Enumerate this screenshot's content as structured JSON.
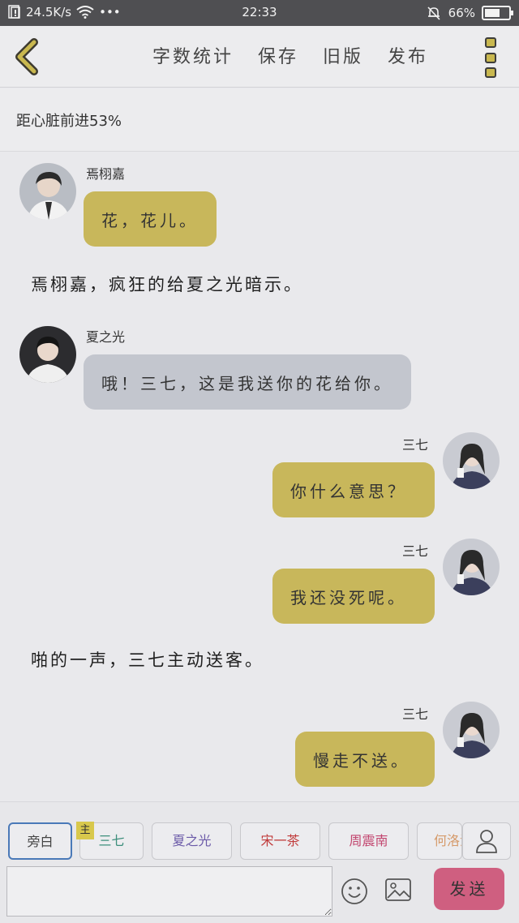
{
  "status_bar": {
    "net_speed": "24.5K/s",
    "dots": "•••",
    "time": "22:33",
    "battery": "66%",
    "battery_level": 0.66
  },
  "top_bar": {
    "actions": [
      "字数统计",
      "保存",
      "旧版",
      "发布"
    ]
  },
  "progress_text": "距心脏前进53%",
  "messages": [
    {
      "type": "msg",
      "side": "left",
      "sender": "焉栩嘉",
      "text": "花，花儿。",
      "color": "gold"
    },
    {
      "type": "narration",
      "text": "焉栩嘉，疯狂的给夏之光暗示。"
    },
    {
      "type": "msg",
      "side": "left",
      "sender": "夏之光",
      "text": "哦！三七，这是我送你的花给你。",
      "color": "gray"
    },
    {
      "type": "msg",
      "side": "right",
      "sender": "三七",
      "text": "你什么意思？",
      "color": "gold"
    },
    {
      "type": "msg",
      "side": "right",
      "sender": "三七",
      "text": "我还没死呢。",
      "color": "gold"
    },
    {
      "type": "narration",
      "text": "啪的一声，三七主动送客。"
    },
    {
      "type": "msg",
      "side": "right",
      "sender": "三七",
      "text": "慢走不送。",
      "color": "gold"
    }
  ],
  "roles": [
    {
      "label": "旁白",
      "color": "#444444"
    },
    {
      "label": "三七",
      "color": "#3d8f7c"
    },
    {
      "label": "夏之光",
      "color": "#6b5aa8"
    },
    {
      "label": "宋一茶",
      "color": "#c03a3a"
    },
    {
      "label": "周震南",
      "color": "#c2466f"
    },
    {
      "label": "何洛洛",
      "color": "#d59a6a"
    }
  ],
  "main_badge": "主",
  "input": {
    "value": "",
    "placeholder": ""
  },
  "send_label": "发送",
  "icons": {
    "back": "chevron-left-icon",
    "more": "more-vertical-icon",
    "user": "user-icon",
    "emoji": "smiley-icon",
    "image": "image-icon"
  },
  "colors": {
    "accent": "#c8b75b",
    "bubble_gray": "#c3c6ce",
    "send": "#cf5f80",
    "active_role_border": "#4a79b8"
  }
}
